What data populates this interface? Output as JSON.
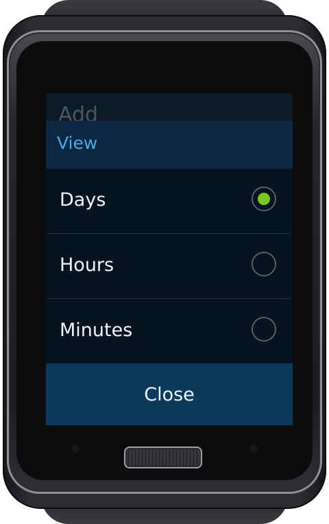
{
  "background": {
    "title_partial": "Add"
  },
  "dialog": {
    "title": "View",
    "options": [
      {
        "label": "Days",
        "selected": true
      },
      {
        "label": "Hours",
        "selected": false
      },
      {
        "label": "Minutes",
        "selected": false
      }
    ],
    "close_label": "Close"
  },
  "colors": {
    "accent_title": "#4ea7e6",
    "selected_radio": "#7bc521",
    "dialog_header": "#0c2842",
    "close_button": "#0c3a5a"
  }
}
